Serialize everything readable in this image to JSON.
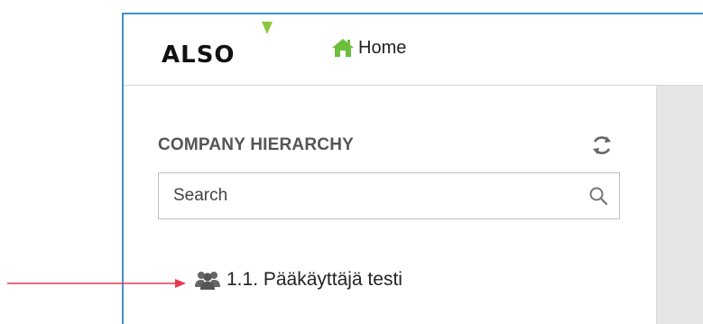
{
  "header": {
    "logo_text": "ALSO",
    "home_label": "Home"
  },
  "hierarchy": {
    "title": "COMPANY HIERARCHY",
    "search_placeholder": "Search",
    "items": [
      {
        "label": "1.1. Pääkäyttäjä testi",
        "icon": "users-icon"
      }
    ]
  },
  "colors": {
    "frame_border": "#3f8fd0",
    "logo_accent": "#8cc63f",
    "home_icon": "#6cbf3c",
    "annotation_arrow": "#e8384f"
  }
}
